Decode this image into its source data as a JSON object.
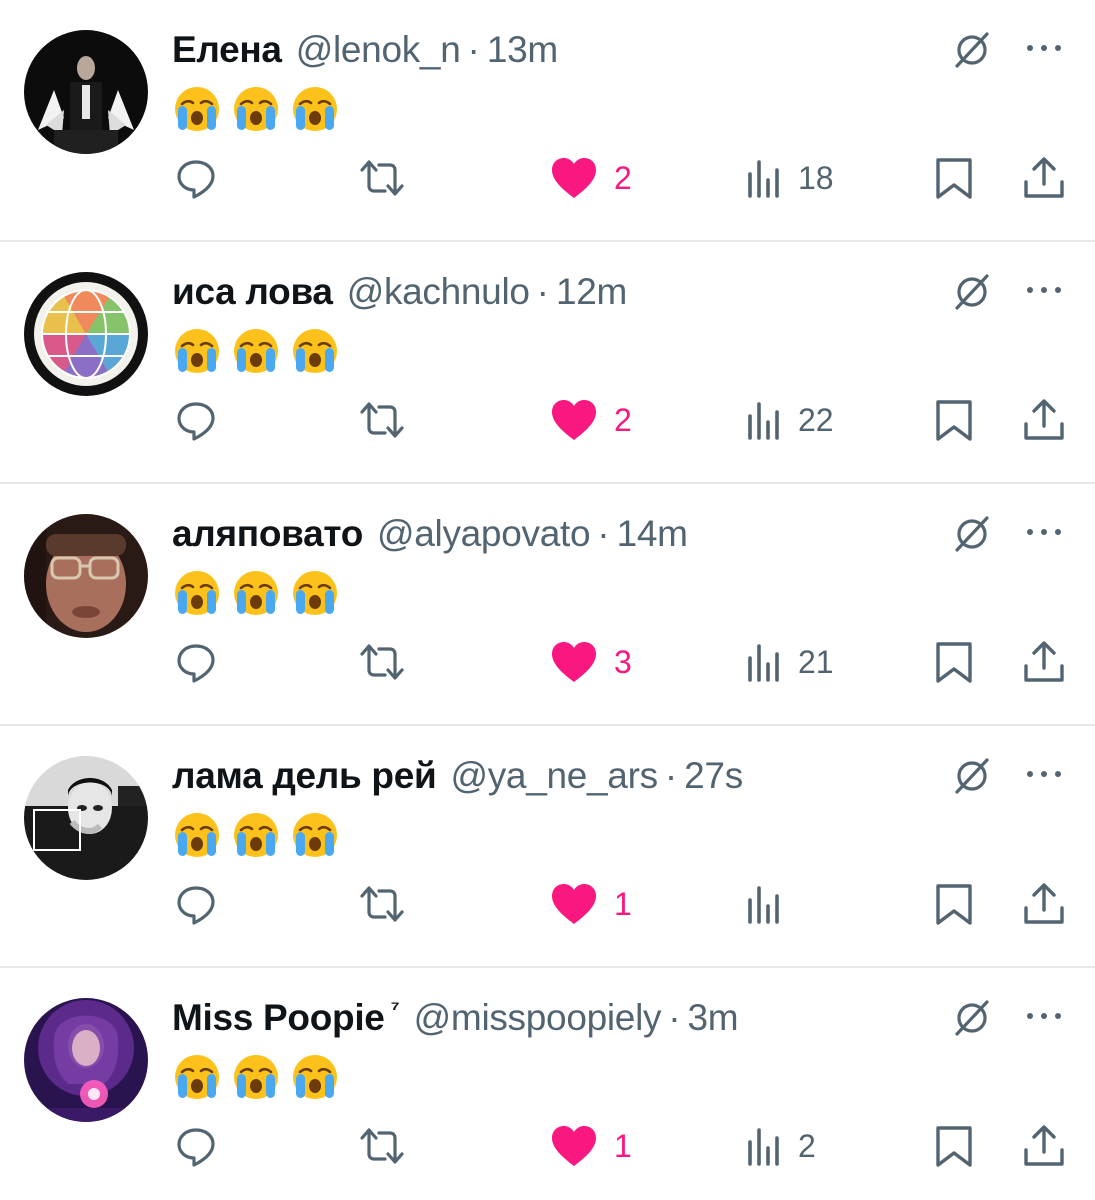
{
  "colors": {
    "text": "#0f1419",
    "secondary": "#536471",
    "like": "#f91880",
    "divider": "#e6e9ec"
  },
  "tweets": [
    {
      "name": "Елена",
      "name_badge": "",
      "handle": "@lenok_n",
      "separator": "·",
      "time": "13m",
      "content_emojis": [
        "crying-face",
        "crying-face",
        "crying-face"
      ],
      "likes": "2",
      "views": "18",
      "liked": true
    },
    {
      "name": "иса лова",
      "name_badge": "",
      "handle": "@kachnulo",
      "separator": "·",
      "time": "12m",
      "content_emojis": [
        "crying-face",
        "crying-face",
        "crying-face"
      ],
      "likes": "2",
      "views": "22",
      "liked": true
    },
    {
      "name": "аляповато",
      "name_badge": "",
      "handle": "@alyapovato",
      "separator": "·",
      "time": "14m",
      "content_emojis": [
        "crying-face",
        "crying-face",
        "crying-face"
      ],
      "likes": "3",
      "views": "21",
      "liked": true
    },
    {
      "name": "лама дель рей",
      "name_badge": "",
      "handle": "@ya_ne_ars",
      "separator": "·",
      "time": "27s",
      "content_emojis": [
        "crying-face",
        "crying-face",
        "crying-face"
      ],
      "likes": "1",
      "views": "",
      "liked": true
    },
    {
      "name": "Miss Poopie",
      "name_badge": "⁷",
      "handle": "@misspoopiely",
      "separator": "·",
      "time": "3m",
      "content_emojis": [
        "crying-face",
        "crying-face",
        "crying-face"
      ],
      "likes": "1",
      "views": "2",
      "liked": true
    }
  ]
}
